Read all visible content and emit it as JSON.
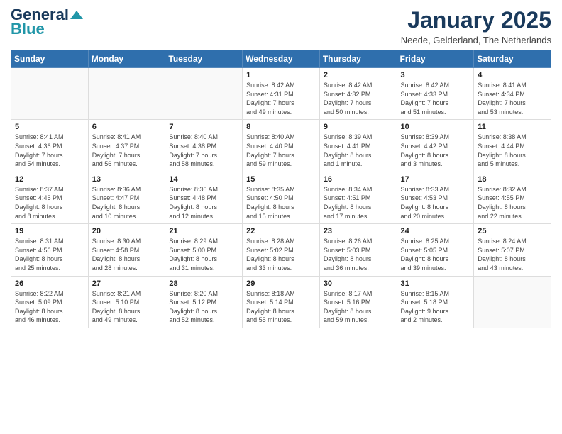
{
  "header": {
    "logo_line1": "General",
    "logo_line2": "Blue",
    "month_title": "January 2025",
    "subtitle": "Neede, Gelderland, The Netherlands"
  },
  "calendar": {
    "days_of_week": [
      "Sunday",
      "Monday",
      "Tuesday",
      "Wednesday",
      "Thursday",
      "Friday",
      "Saturday"
    ],
    "weeks": [
      [
        {
          "day": "",
          "info": ""
        },
        {
          "day": "",
          "info": ""
        },
        {
          "day": "",
          "info": ""
        },
        {
          "day": "1",
          "info": "Sunrise: 8:42 AM\nSunset: 4:31 PM\nDaylight: 7 hours\nand 49 minutes."
        },
        {
          "day": "2",
          "info": "Sunrise: 8:42 AM\nSunset: 4:32 PM\nDaylight: 7 hours\nand 50 minutes."
        },
        {
          "day": "3",
          "info": "Sunrise: 8:42 AM\nSunset: 4:33 PM\nDaylight: 7 hours\nand 51 minutes."
        },
        {
          "day": "4",
          "info": "Sunrise: 8:41 AM\nSunset: 4:34 PM\nDaylight: 7 hours\nand 53 minutes."
        }
      ],
      [
        {
          "day": "5",
          "info": "Sunrise: 8:41 AM\nSunset: 4:36 PM\nDaylight: 7 hours\nand 54 minutes."
        },
        {
          "day": "6",
          "info": "Sunrise: 8:41 AM\nSunset: 4:37 PM\nDaylight: 7 hours\nand 56 minutes."
        },
        {
          "day": "7",
          "info": "Sunrise: 8:40 AM\nSunset: 4:38 PM\nDaylight: 7 hours\nand 58 minutes."
        },
        {
          "day": "8",
          "info": "Sunrise: 8:40 AM\nSunset: 4:40 PM\nDaylight: 7 hours\nand 59 minutes."
        },
        {
          "day": "9",
          "info": "Sunrise: 8:39 AM\nSunset: 4:41 PM\nDaylight: 8 hours\nand 1 minute."
        },
        {
          "day": "10",
          "info": "Sunrise: 8:39 AM\nSunset: 4:42 PM\nDaylight: 8 hours\nand 3 minutes."
        },
        {
          "day": "11",
          "info": "Sunrise: 8:38 AM\nSunset: 4:44 PM\nDaylight: 8 hours\nand 5 minutes."
        }
      ],
      [
        {
          "day": "12",
          "info": "Sunrise: 8:37 AM\nSunset: 4:45 PM\nDaylight: 8 hours\nand 8 minutes."
        },
        {
          "day": "13",
          "info": "Sunrise: 8:36 AM\nSunset: 4:47 PM\nDaylight: 8 hours\nand 10 minutes."
        },
        {
          "day": "14",
          "info": "Sunrise: 8:36 AM\nSunset: 4:48 PM\nDaylight: 8 hours\nand 12 minutes."
        },
        {
          "day": "15",
          "info": "Sunrise: 8:35 AM\nSunset: 4:50 PM\nDaylight: 8 hours\nand 15 minutes."
        },
        {
          "day": "16",
          "info": "Sunrise: 8:34 AM\nSunset: 4:51 PM\nDaylight: 8 hours\nand 17 minutes."
        },
        {
          "day": "17",
          "info": "Sunrise: 8:33 AM\nSunset: 4:53 PM\nDaylight: 8 hours\nand 20 minutes."
        },
        {
          "day": "18",
          "info": "Sunrise: 8:32 AM\nSunset: 4:55 PM\nDaylight: 8 hours\nand 22 minutes."
        }
      ],
      [
        {
          "day": "19",
          "info": "Sunrise: 8:31 AM\nSunset: 4:56 PM\nDaylight: 8 hours\nand 25 minutes."
        },
        {
          "day": "20",
          "info": "Sunrise: 8:30 AM\nSunset: 4:58 PM\nDaylight: 8 hours\nand 28 minutes."
        },
        {
          "day": "21",
          "info": "Sunrise: 8:29 AM\nSunset: 5:00 PM\nDaylight: 8 hours\nand 31 minutes."
        },
        {
          "day": "22",
          "info": "Sunrise: 8:28 AM\nSunset: 5:02 PM\nDaylight: 8 hours\nand 33 minutes."
        },
        {
          "day": "23",
          "info": "Sunrise: 8:26 AM\nSunset: 5:03 PM\nDaylight: 8 hours\nand 36 minutes."
        },
        {
          "day": "24",
          "info": "Sunrise: 8:25 AM\nSunset: 5:05 PM\nDaylight: 8 hours\nand 39 minutes."
        },
        {
          "day": "25",
          "info": "Sunrise: 8:24 AM\nSunset: 5:07 PM\nDaylight: 8 hours\nand 43 minutes."
        }
      ],
      [
        {
          "day": "26",
          "info": "Sunrise: 8:22 AM\nSunset: 5:09 PM\nDaylight: 8 hours\nand 46 minutes."
        },
        {
          "day": "27",
          "info": "Sunrise: 8:21 AM\nSunset: 5:10 PM\nDaylight: 8 hours\nand 49 minutes."
        },
        {
          "day": "28",
          "info": "Sunrise: 8:20 AM\nSunset: 5:12 PM\nDaylight: 8 hours\nand 52 minutes."
        },
        {
          "day": "29",
          "info": "Sunrise: 8:18 AM\nSunset: 5:14 PM\nDaylight: 8 hours\nand 55 minutes."
        },
        {
          "day": "30",
          "info": "Sunrise: 8:17 AM\nSunset: 5:16 PM\nDaylight: 8 hours\nand 59 minutes."
        },
        {
          "day": "31",
          "info": "Sunrise: 8:15 AM\nSunset: 5:18 PM\nDaylight: 9 hours\nand 2 minutes."
        },
        {
          "day": "",
          "info": ""
        }
      ]
    ]
  }
}
